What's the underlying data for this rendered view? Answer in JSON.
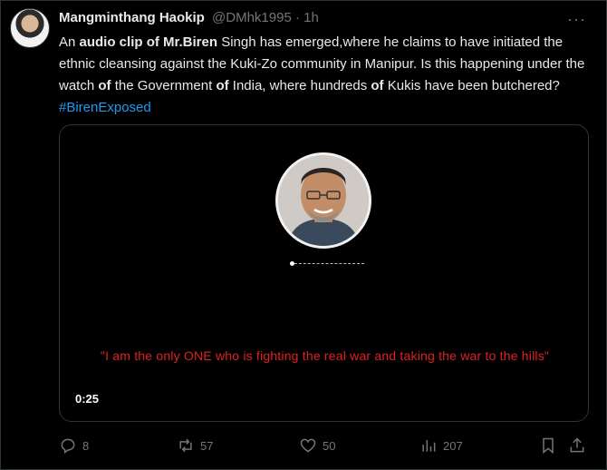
{
  "tweet": {
    "author_name": "Mangminthang Haokip",
    "handle_time": "@DMhk1995 · 1h",
    "more_label": "···",
    "text": {
      "p1": "An ",
      "b1": "audio clip of Mr.Biren",
      "p2": " Singh has emerged,where he claims to have initiated the ethnic cleansing against the Kuki-Zo community in Manipur. Is this happening under the watch ",
      "b2": "of",
      "p3": " the Government ",
      "b3": "of",
      "p4": " India, where hundreds ",
      "b4": "of",
      "p5": " Kukis have been butchered? ",
      "hashtag": "#BirenExposed"
    }
  },
  "media": {
    "quote": "\"I am the only ONE who is fighting the real war and taking the war to the hills\"",
    "timer": "0:25",
    "progress": 0.02
  },
  "actions": {
    "replies": "8",
    "reposts": "57",
    "likes": "50",
    "views": "207"
  },
  "colors": {
    "accent": "#1d9bf0",
    "quote": "#e02020",
    "muted": "#71767b"
  }
}
